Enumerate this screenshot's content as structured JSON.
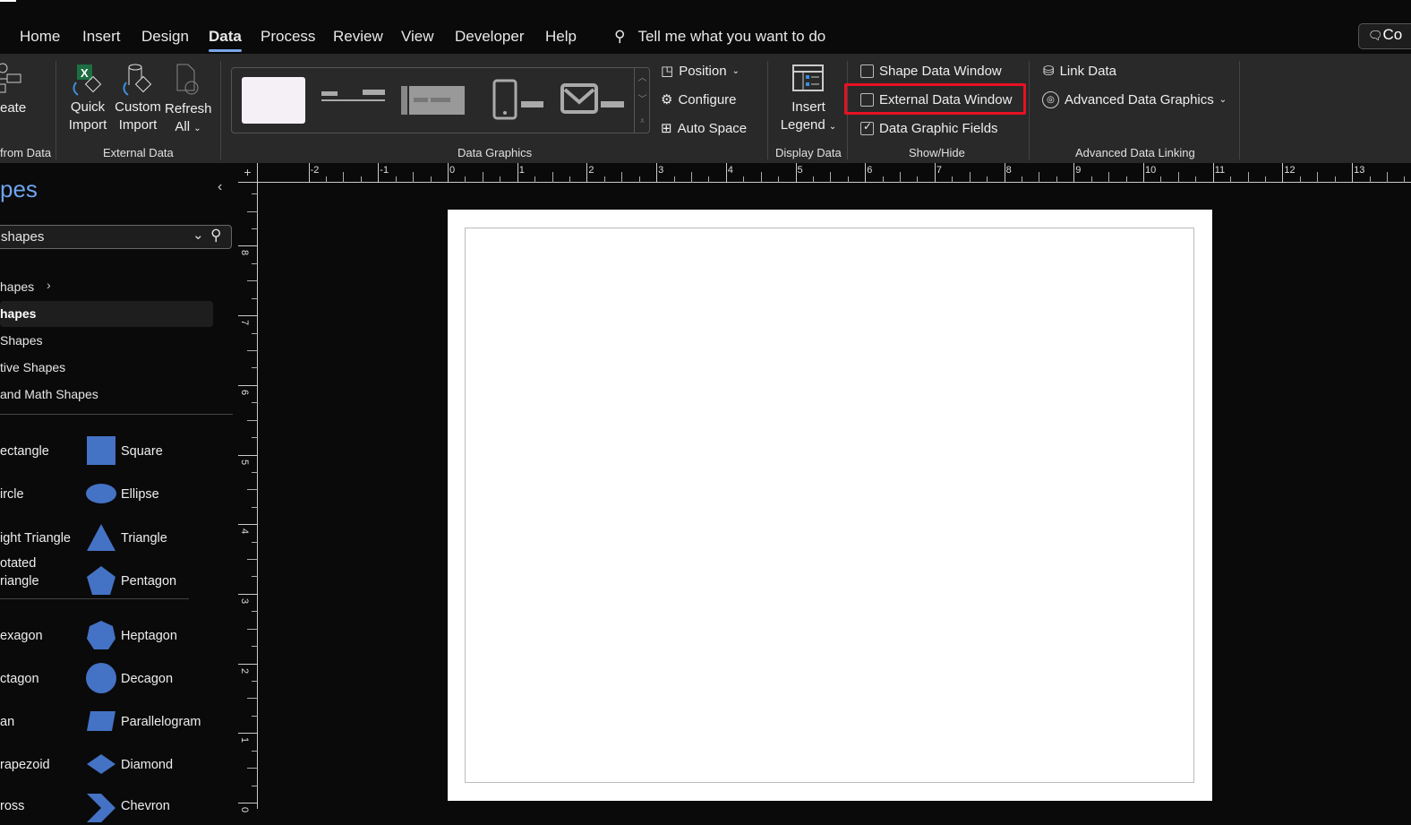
{
  "tabs": [
    "Home",
    "Insert",
    "Design",
    "Data",
    "Process",
    "Review",
    "View",
    "Developer",
    "Help"
  ],
  "active_tab": "Data",
  "search_placeholder": "Tell me what you want to do",
  "comments_button": "Co",
  "ribbon": {
    "create_from_data": {
      "button": "eate",
      "label": "from Data"
    },
    "external_data": {
      "label": "External Data",
      "quick_import": [
        "Quick",
        "Import"
      ],
      "custom_import": [
        "Custom",
        "Import"
      ],
      "refresh_all": [
        "Refresh",
        "All"
      ]
    },
    "data_graphics": {
      "label": "Data Graphics",
      "position": "Position",
      "configure": "Configure",
      "auto_space": "Auto Space"
    },
    "display_data": {
      "label": "Display Data",
      "insert_legend": [
        "Insert",
        "Legend"
      ]
    },
    "show_hide": {
      "label": "Show/Hide",
      "shape_data_window": {
        "text": "Shape Data Window",
        "checked": false
      },
      "external_data_window": {
        "text": "External Data Window",
        "checked": false,
        "highlighted": true
      },
      "data_graphic_fields": {
        "text": "Data Graphic Fields",
        "checked": true
      }
    },
    "advanced": {
      "label": "Advanced Data Linking",
      "link_data": "Link Data",
      "advanced_data_graphics": "Advanced Data Graphics"
    }
  },
  "sidebar": {
    "title": "pes",
    "search_value": "shapes",
    "categories": [
      "hapes",
      "hapes",
      "Shapes",
      "tive Shapes",
      "and Math Shapes"
    ],
    "selected_category": 1,
    "shapes_left": [
      "ectangle",
      "ircle",
      "ight Triangle",
      "otated\nriangle",
      "exagon",
      "ctagon",
      "an",
      "rapezoid",
      "ross"
    ],
    "shapes_right": [
      "Square",
      "Ellipse",
      "Triangle",
      "Pentagon",
      "Heptagon",
      "Decagon",
      "Parallelogram",
      "Diamond",
      "Chevron"
    ]
  },
  "ruler_top": [
    "-2",
    "-1",
    "0",
    "1",
    "2",
    "3",
    "4",
    "5",
    "6",
    "7",
    "8",
    "9",
    "10",
    "11",
    "12",
    "13"
  ],
  "ruler_left": [
    "8",
    "7",
    "6",
    "5",
    "4",
    "3",
    "2",
    "1",
    "0"
  ],
  "colors": {
    "accent": "#7aa7e8",
    "shape_fill": "#4472c4",
    "highlight": "#e81123",
    "excel": "#1d6f42"
  }
}
